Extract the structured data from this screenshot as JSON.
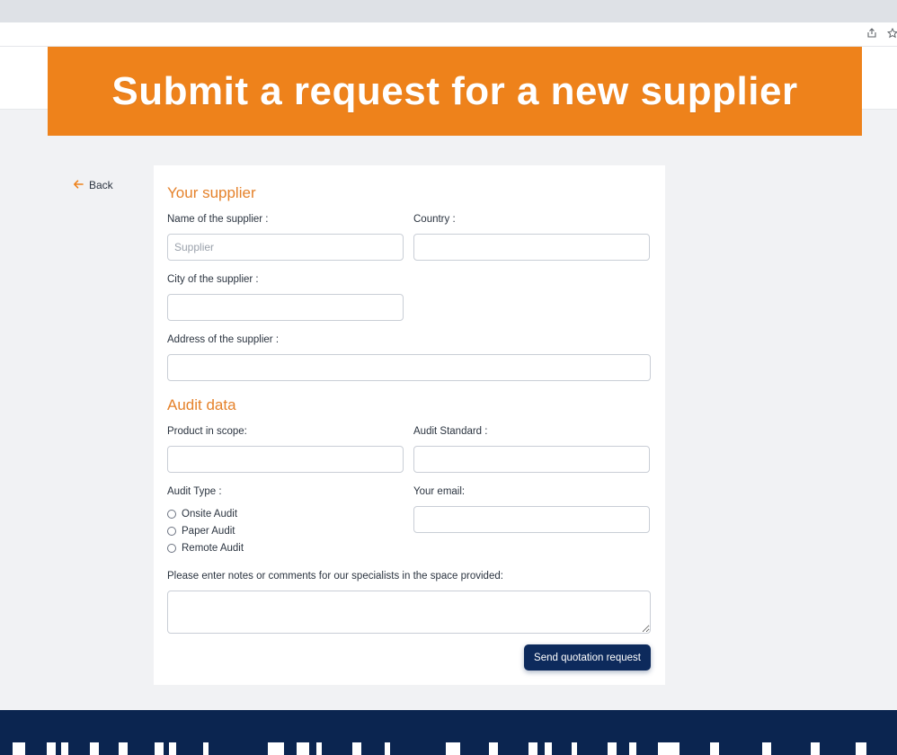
{
  "banner": {
    "title": "Submit a request for a new supplier"
  },
  "nav": {
    "back_label": "Back"
  },
  "supplier_section": {
    "title": "Your supplier",
    "name_label": "Name of the supplier :",
    "name_placeholder": "Supplier",
    "name_value": "",
    "country_label": "Country :",
    "country_value": "",
    "city_label": "City of the supplier :",
    "city_value": "",
    "address_label": "Address of the supplier :",
    "address_value": ""
  },
  "audit_section": {
    "title": "Audit data",
    "product_label": "Product in scope:",
    "product_value": "",
    "standard_label": "Audit Standard :",
    "standard_value": "",
    "type_label": "Audit Type :",
    "type_options": [
      "Onsite Audit",
      "Paper Audit",
      "Remote Audit"
    ],
    "email_label": "Your email:",
    "email_value": "",
    "notes_label": "Please enter notes or comments for our specialists in the space provided:",
    "notes_value": ""
  },
  "actions": {
    "submit_label": "Send quotation request"
  },
  "colors": {
    "accent": "#ee821b",
    "section_title": "#e5822b",
    "primary_button": "#0d2a5c",
    "footer": "#0b2550"
  },
  "icons": {
    "back": "arrow-left-icon",
    "share": "share-icon",
    "bookmark": "star-icon"
  }
}
